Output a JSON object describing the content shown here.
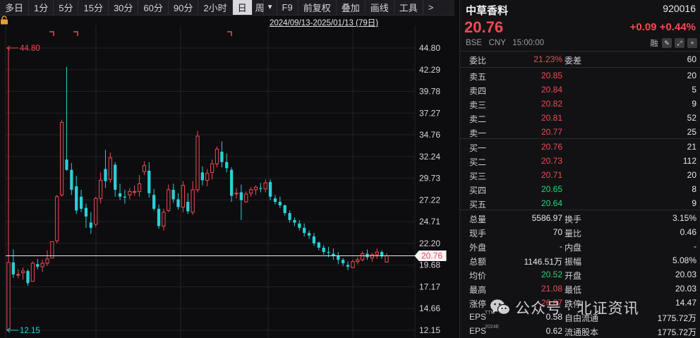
{
  "toolbar": {
    "items": [
      "多日",
      "1分",
      "5分",
      "15分",
      "30分",
      "60分",
      "90分",
      "2小时",
      "日",
      "周",
      "F9",
      "前复权",
      "叠加",
      "画线",
      "工具",
      ">"
    ],
    "active": "日"
  },
  "chart": {
    "date_range": "2024/09/13-2025/01/13 (79日)",
    "high_marker": "44.80",
    "low_marker": "12.15",
    "last_price_tag": "20.76",
    "colors": {
      "up": "#f14a52",
      "down": "#2ad0d8",
      "grid": "#222226",
      "axis_text": "#d6d6da",
      "last_line": "#e8e8ec"
    }
  },
  "chart_data": {
    "type": "candlestick",
    "y_ticks": [
      "44.80",
      "42.29",
      "39.78",
      "37.27",
      "34.76",
      "32.24",
      "29.73",
      "27.22",
      "24.71",
      "22.20",
      "19.68",
      "17.17",
      "14.66",
      "12.15"
    ],
    "ylim": [
      12.15,
      44.8
    ],
    "last": 20.76,
    "ohlc": [
      [
        12.15,
        44.8,
        12.15,
        20.0
      ],
      [
        20.0,
        21.5,
        18.2,
        18.6
      ],
      [
        18.6,
        19.2,
        18.2,
        18.6
      ],
      [
        18.8,
        19.4,
        18.0,
        19.0
      ],
      [
        19.0,
        19.2,
        17.3,
        17.6
      ],
      [
        17.8,
        20.1,
        17.8,
        19.9
      ],
      [
        19.8,
        20.4,
        19.2,
        19.5
      ],
      [
        19.5,
        20.3,
        18.9,
        19.9
      ],
      [
        19.9,
        21.4,
        19.6,
        20.4
      ],
      [
        20.5,
        22.4,
        20.5,
        22.4
      ],
      [
        22.5,
        27.8,
        22.2,
        27.6
      ],
      [
        27.8,
        36.5,
        27.6,
        36.2
      ],
      [
        31.9,
        42.6,
        30.6,
        30.7
      ],
      [
        30.7,
        31.5,
        27.8,
        28.4
      ],
      [
        28.8,
        30.0,
        25.6,
        26.0
      ],
      [
        27.6,
        28.4,
        25.8,
        26.2
      ],
      [
        26.3,
        26.8,
        24.0,
        25.3
      ],
      [
        24.6,
        25.8,
        23.3,
        24.0
      ],
      [
        24.4,
        27.6,
        24.1,
        27.4
      ],
      [
        27.4,
        30.4,
        26.8,
        29.5
      ],
      [
        30.8,
        33.0,
        28.6,
        29.4
      ],
      [
        29.6,
        32.7,
        29.2,
        32.1
      ],
      [
        31.3,
        31.6,
        27.6,
        28.4
      ],
      [
        28.0,
        29.1,
        27.2,
        27.6
      ],
      [
        27.6,
        28.4,
        26.8,
        27.5
      ],
      [
        27.8,
        28.6,
        27.3,
        28.2
      ],
      [
        28.1,
        28.9,
        27.7,
        28.2
      ],
      [
        28.2,
        30.1,
        27.6,
        29.1
      ],
      [
        30.5,
        31.7,
        30.1,
        31.2
      ],
      [
        30.6,
        31.6,
        27.5,
        28.0
      ],
      [
        27.8,
        28.5,
        26.0,
        26.2
      ],
      [
        26.2,
        26.7,
        23.9,
        24.2
      ],
      [
        24.2,
        26.2,
        23.7,
        25.8
      ],
      [
        26.0,
        29.0,
        25.8,
        28.4
      ],
      [
        28.4,
        29.1,
        26.9,
        27.3
      ],
      [
        27.3,
        28.0,
        26.1,
        26.4
      ],
      [
        26.4,
        29.4,
        25.8,
        28.9
      ],
      [
        27.0,
        28.0,
        25.6,
        25.9
      ],
      [
        25.8,
        29.4,
        25.5,
        28.4
      ],
      [
        28.4,
        35.2,
        28.1,
        34.6
      ],
      [
        30.4,
        31.1,
        28.9,
        29.5
      ],
      [
        29.5,
        30.8,
        28.8,
        30.3
      ],
      [
        30.4,
        31.9,
        29.6,
        31.4
      ],
      [
        31.4,
        33.4,
        31.0,
        33.1
      ],
      [
        32.8,
        34.0,
        31.0,
        31.6
      ],
      [
        31.6,
        32.6,
        30.4,
        30.9
      ],
      [
        30.7,
        31.0,
        27.0,
        27.7
      ],
      [
        28.0,
        28.6,
        27.4,
        28.0
      ],
      [
        28.1,
        29.0,
        24.9,
        27.2
      ],
      [
        27.0,
        28.2,
        26.9,
        27.9
      ],
      [
        28.0,
        28.7,
        27.6,
        28.4
      ],
      [
        28.4,
        28.9,
        27.8,
        28.7
      ],
      [
        28.6,
        29.2,
        28.1,
        28.5
      ],
      [
        28.5,
        29.6,
        28.1,
        29.2
      ],
      [
        29.3,
        29.6,
        27.2,
        27.6
      ],
      [
        27.4,
        27.8,
        26.7,
        27.0
      ],
      [
        27.0,
        27.6,
        26.3,
        26.6
      ],
      [
        26.6,
        26.7,
        25.4,
        25.7
      ],
      [
        25.7,
        26.0,
        24.6,
        24.9
      ],
      [
        24.9,
        25.2,
        24.2,
        24.6
      ],
      [
        24.5,
        24.9,
        23.7,
        24.0
      ],
      [
        24.0,
        24.5,
        23.0,
        23.4
      ],
      [
        23.4,
        23.7,
        22.7,
        23.1
      ],
      [
        23.0,
        23.4,
        21.9,
        22.2
      ],
      [
        22.3,
        22.4,
        21.4,
        21.7
      ],
      [
        21.7,
        22.0,
        20.9,
        21.2
      ],
      [
        21.2,
        21.8,
        20.6,
        21.1
      ],
      [
        21.0,
        21.6,
        20.3,
        20.8
      ],
      [
        20.8,
        21.2,
        19.8,
        20.3
      ],
      [
        20.3,
        20.5,
        19.6,
        19.9
      ],
      [
        19.7,
        20.1,
        19.1,
        19.5
      ],
      [
        19.4,
        20.3,
        19.3,
        20.1
      ],
      [
        20.1,
        20.6,
        19.8,
        20.3
      ],
      [
        20.3,
        21.3,
        20.1,
        21.0
      ],
      [
        21.0,
        21.5,
        20.3,
        20.6
      ],
      [
        20.5,
        21.1,
        20.1,
        20.9
      ],
      [
        20.9,
        21.6,
        20.4,
        21.2
      ],
      [
        21.2,
        21.4,
        20.4,
        20.7
      ],
      [
        20.03,
        21.08,
        20.03,
        20.76
      ]
    ]
  },
  "panel": {
    "name": "中草香料",
    "code": "920016",
    "price": "20.76",
    "change": "+0.09",
    "change_pct": "+0.44%",
    "meta": "BSE   CNY   15:00:00",
    "margin_label": "融",
    "webi": {
      "label": "委比",
      "value": "21.23%",
      "label2": "委差",
      "value2": "60"
    },
    "asks": [
      {
        "label": "卖五",
        "price": "20.85",
        "qty": "20"
      },
      {
        "label": "卖四",
        "price": "20.84",
        "qty": "5"
      },
      {
        "label": "卖三",
        "price": "20.82",
        "qty": "9"
      },
      {
        "label": "卖二",
        "price": "20.81",
        "qty": "52"
      },
      {
        "label": "卖一",
        "price": "20.77",
        "qty": "25"
      }
    ],
    "bids": [
      {
        "label": "买一",
        "price": "20.76",
        "qty": "21",
        "color": "red"
      },
      {
        "label": "买二",
        "price": "20.73",
        "qty": "112",
        "color": "red"
      },
      {
        "label": "买三",
        "price": "20.71",
        "qty": "20",
        "color": "red"
      },
      {
        "label": "买四",
        "price": "20.65",
        "qty": "8",
        "color": "green"
      },
      {
        "label": "买五",
        "price": "20.64",
        "qty": "9",
        "color": "green"
      }
    ],
    "stats": [
      {
        "l1": "总量",
        "v1": "5586.97",
        "c1": "white",
        "l2": "换手",
        "v2": "3.15%",
        "c2": "white"
      },
      {
        "l1": "现手",
        "v1": "70",
        "c1": "white",
        "l2": "量比",
        "v2": "0.46",
        "c2": "white"
      },
      {
        "l1": "外盘",
        "v1": "-",
        "c1": "white",
        "l2": "内盘",
        "v2": "-",
        "c2": "white"
      },
      {
        "l1": "总额",
        "v1": "1146.51万",
        "c1": "white",
        "l2": "振幅",
        "v2": "5.08%",
        "c2": "white"
      },
      {
        "l1": "均价",
        "v1": "20.52",
        "c1": "green",
        "l2": "开盘",
        "v2": "20.03",
        "c2": "green"
      },
      {
        "l1": "最高",
        "v1": "21.08",
        "c1": "red",
        "l2": "最低",
        "v2": "20.03",
        "c2": "green"
      },
      {
        "l1": "涨停",
        "v1": "26.87",
        "c1": "red",
        "l2": "跌停",
        "v2": "14.47",
        "c2": "green"
      },
      {
        "l1": "EPS",
        "sup": "TTM",
        "v1": "0.58",
        "c1": "white",
        "l2": "自由流通",
        "v2": "1775.72万",
        "c2": "white"
      },
      {
        "l1": "EPS",
        "sup": "2024E",
        "v1": "0.62",
        "c1": "white",
        "l2": "流通股本",
        "v2": "1775.72万",
        "c2": "white"
      }
    ]
  },
  "watermark": {
    "text": "公众号 · 北证资讯"
  }
}
